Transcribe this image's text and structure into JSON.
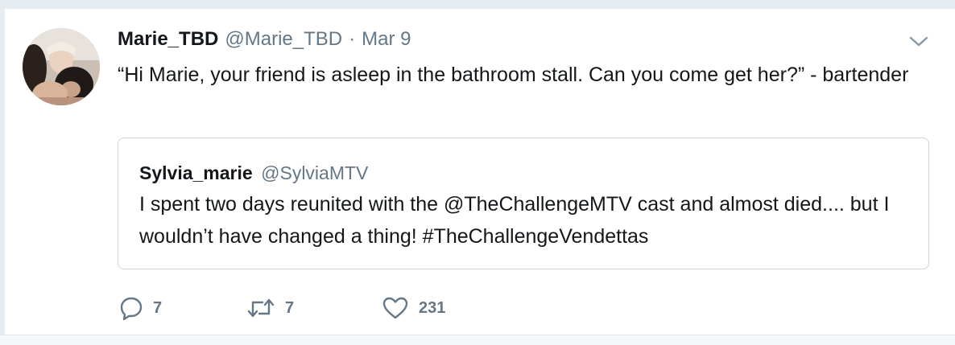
{
  "tweet": {
    "author_name": "Marie_TBD",
    "author_handle": "@Marie_TBD",
    "separator": "·",
    "date": "Mar 9",
    "text": "“Hi Marie, your friend is asleep in the bathroom stall. Can you come get her?” - bartender",
    "menu_icon": "chevron-down-icon",
    "avatar": "user-avatar-photo"
  },
  "quoted_tweet": {
    "author_name": "Sylvia_marie",
    "author_handle": "@SylviaMTV",
    "text": "I spent two days reunited with the @TheChallengeMTV cast and almost died.... but I wouldn’t have changed a thing! #TheChallengeVendettas"
  },
  "actions": {
    "reply": {
      "icon": "reply-icon",
      "count": "7"
    },
    "retweet": {
      "icon": "retweet-icon",
      "count": "7"
    },
    "like": {
      "icon": "heart-icon",
      "count": "231"
    }
  },
  "colors": {
    "text": "#14171a",
    "secondary": "#657786",
    "border": "#ccd6dd",
    "background": "#e6ecf0"
  }
}
